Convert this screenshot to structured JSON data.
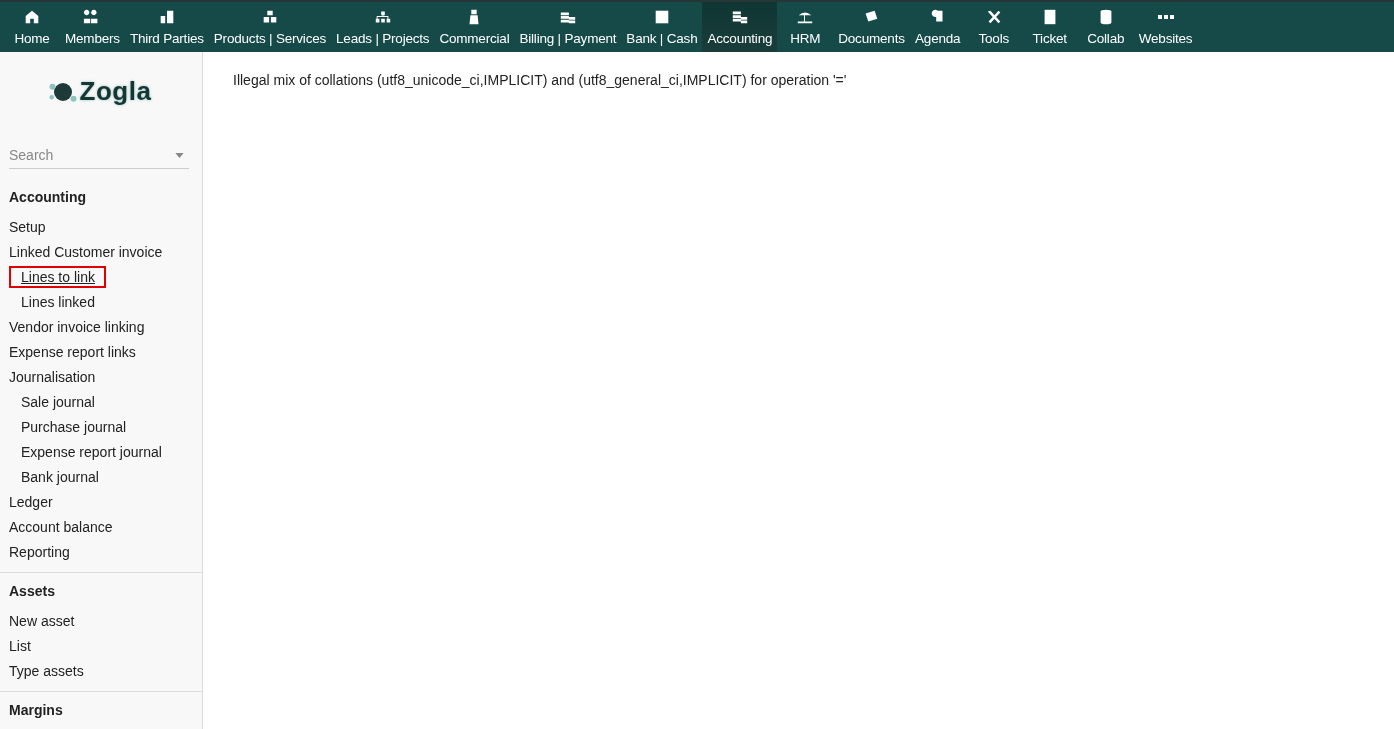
{
  "top_menu": [
    {
      "label": "Home",
      "selected": false
    },
    {
      "label": "Members",
      "selected": false
    },
    {
      "label": "Third Parties",
      "selected": false
    },
    {
      "label": "Products | Services",
      "selected": false
    },
    {
      "label": "Leads | Projects",
      "selected": false
    },
    {
      "label": "Commercial",
      "selected": false
    },
    {
      "label": "Billing | Payment",
      "selected": false
    },
    {
      "label": "Bank | Cash",
      "selected": false
    },
    {
      "label": "Accounting",
      "selected": true
    },
    {
      "label": "HRM",
      "selected": false
    },
    {
      "label": "Documents",
      "selected": false
    },
    {
      "label": "Agenda",
      "selected": false
    },
    {
      "label": "Tools",
      "selected": false
    },
    {
      "label": "Ticket",
      "selected": false
    },
    {
      "label": "Collab",
      "selected": false
    },
    {
      "label": "Websites",
      "selected": false
    }
  ],
  "sidebar": {
    "logo": "Zogla",
    "search": {
      "placeholder": "Search"
    },
    "sections": [
      {
        "title": "Accounting",
        "items": [
          {
            "label": "Setup",
            "selected": false
          },
          {
            "label": "Linked Customer invoice",
            "selected": false,
            "children": [
              {
                "label": "Lines to link",
                "selected": true
              },
              {
                "label": "Lines linked",
                "selected": false
              }
            ]
          },
          {
            "label": "Vendor invoice linking",
            "selected": false
          },
          {
            "label": "Expense report links",
            "selected": false
          },
          {
            "label": "Journalisation",
            "selected": false,
            "children": [
              {
                "label": "Sale journal",
                "selected": false
              },
              {
                "label": "Purchase journal",
                "selected": false
              },
              {
                "label": "Expense report journal",
                "selected": false
              },
              {
                "label": "Bank journal",
                "selected": false
              }
            ]
          },
          {
            "label": "Ledger",
            "selected": false
          },
          {
            "label": "Account balance",
            "selected": false
          },
          {
            "label": "Reporting",
            "selected": false
          }
        ]
      },
      {
        "title": "Assets",
        "items": [
          {
            "label": "New asset",
            "selected": false
          },
          {
            "label": "List",
            "selected": false
          },
          {
            "label": "Type assets",
            "selected": false
          }
        ]
      },
      {
        "title": "Margins"
      }
    ]
  },
  "message": "Illegal mix of collations (utf8_unicode_ci,IMPLICIT) and (utf8_general_ci,IMPLICIT) for operation '='"
}
